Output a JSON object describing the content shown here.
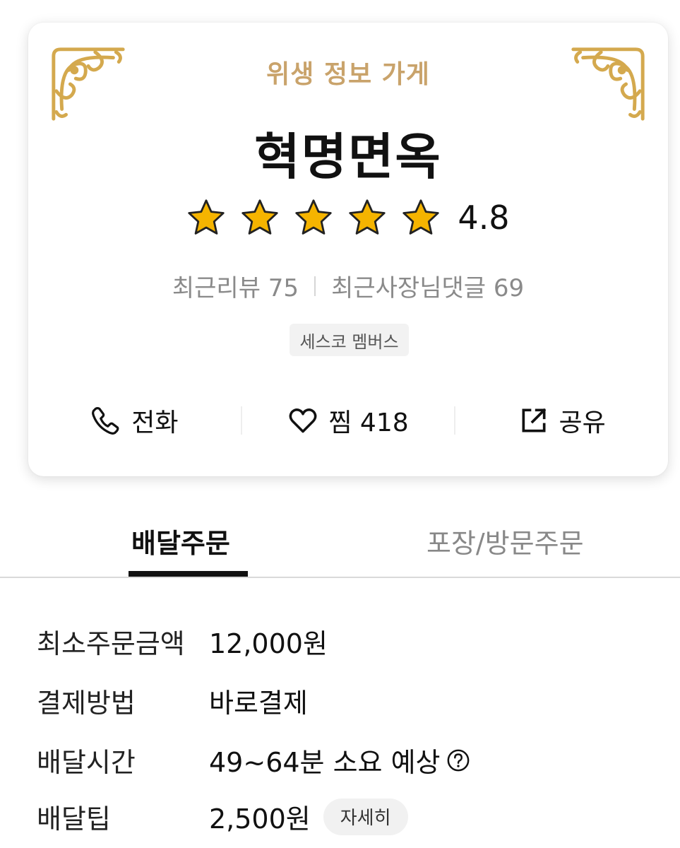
{
  "header": {
    "badge": "위생 정보 가게",
    "store_name": "혁명면옥"
  },
  "rating": {
    "value": "4.8",
    "stars": 5
  },
  "reviews": {
    "recent_reviews": "최근리뷰 75",
    "recent_owner_replies": "최근사장님댓글 69"
  },
  "member_chip": "세스코 멤버스",
  "actions": {
    "call_label": "전화",
    "favorite_label": "찜 418",
    "share_label": "공유"
  },
  "tabs": {
    "delivery": "배달주문",
    "pickup": "포장/방문주문"
  },
  "info": {
    "min_order_label": "최소주문금액",
    "min_order_value": "12,000원",
    "payment_label": "결제방법",
    "payment_value": "바로결제",
    "delivery_time_label": "배달시간",
    "delivery_time_value": "49~64분 소요 예상",
    "delivery_tip_label": "배달팁",
    "delivery_tip_value": "2,500원",
    "detail_button": "자세히"
  },
  "colors": {
    "gold": "#c9a36b",
    "star": "#f5b400",
    "text_gray": "#8a8a8a"
  },
  "icons": [
    "ornament-icon",
    "star-icon",
    "phone-icon",
    "heart-icon",
    "share-icon",
    "help-icon"
  ]
}
